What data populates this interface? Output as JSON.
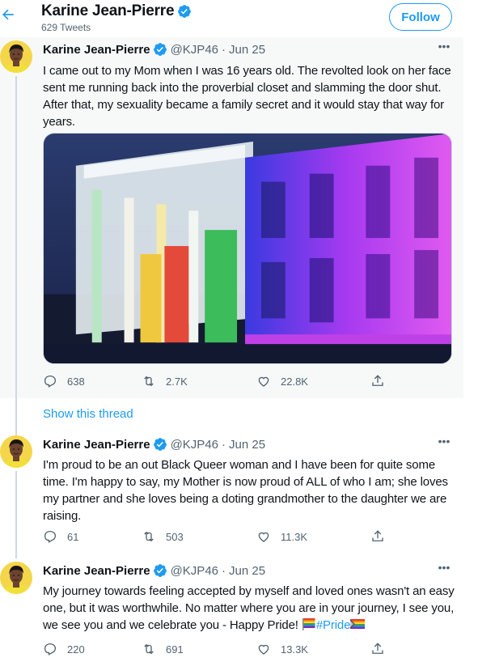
{
  "header": {
    "name": "Karine Jean-Pierre",
    "tweet_count": "629 Tweets",
    "follow_label": "Follow"
  },
  "colors": {
    "accent": "#1d9bf0",
    "secondary_text": "#536471",
    "highlight_bg": "#f7f9f9"
  },
  "tweets": [
    {
      "name": "Karine Jean-Pierre",
      "handle": "@KJP46",
      "dot": "·",
      "date": "Jun 25",
      "text": "I came out to my Mom when I was 16 years old. The revolted look on her face sent me running back into the proverbial closet and slamming the door shut. After that, my sexuality became a family secret and it would stay that way for years.",
      "image": "white-house-lit-in-rainbow-colors",
      "replies": "638",
      "retweets": "2.7K",
      "likes": "22.8K"
    },
    {
      "name": "Karine Jean-Pierre",
      "handle": "@KJP46",
      "dot": "·",
      "date": "Jun 25",
      "text": "I'm proud to be an out Black Queer woman and I have been for quite some time. I'm happy to say, my Mother is now proud of ALL of who I am; she loves my partner and she loves being a doting grandmother to the daughter we are raising.",
      "replies": "61",
      "retweets": "503",
      "likes": "11.3K"
    },
    {
      "name": "Karine Jean-Pierre",
      "handle": "@KJP46",
      "dot": "·",
      "date": "Jun 25",
      "text": "My journey towards feeling accepted by myself and loved ones wasn't an easy one, but it was worthwhile. No matter where you are in your journey, I see you, we see you and we celebrate you  - Happy Pride! ",
      "hashtag": "#Pride",
      "replies": "220",
      "retweets": "691",
      "likes": "13.3K"
    }
  ],
  "show_thread_label": "Show this thread",
  "icons": [
    "back-arrow-icon",
    "verified-badge-icon",
    "more-icon",
    "reply-icon",
    "retweet-icon",
    "like-icon",
    "share-icon",
    "rainbow-flag-emoji",
    "progress-pride-flag-emoji"
  ]
}
